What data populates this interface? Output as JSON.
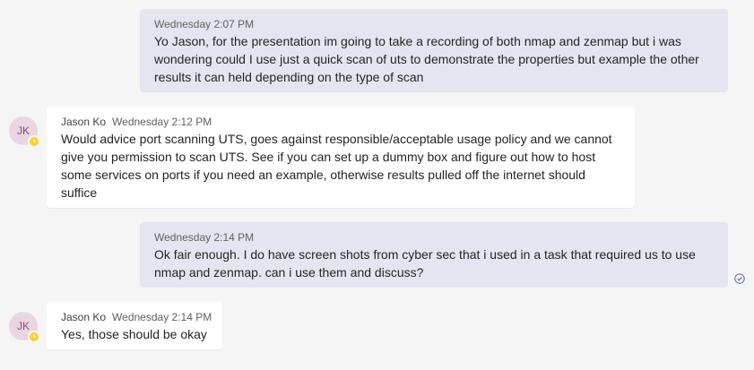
{
  "messages": [
    {
      "sender": "me",
      "timestamp": "Wednesday 2:07 PM",
      "text": "Yo Jason, for the presentation im going to take a recording of both nmap and zenmap but i was wondering could I use just a quick scan of uts to demonstrate the properties but example the other results it can held depending on the type of scan"
    },
    {
      "sender": "other",
      "author": "Jason Ko",
      "initials": "JK",
      "timestamp": "Wednesday 2:12 PM",
      "text": "Would advice port scanning UTS, goes against responsible/acceptable usage policy and we cannot give you permission to scan UTS. See if you can set up a dummy box and figure out how to host some services on ports if you need an example, otherwise results pulled off the internet should suffice"
    },
    {
      "sender": "me",
      "timestamp": "Wednesday 2:14 PM",
      "text": "Ok fair enough. I do have screen shots from cyber sec that i used in a task that required us to use nmap and zenmap. can i use them and discuss?"
    },
    {
      "sender": "other",
      "author": "Jason Ko",
      "initials": "JK",
      "timestamp": "Wednesday 2:14 PM",
      "text": "Yes, those should be okay"
    }
  ],
  "icons": {
    "presence": "away-clock-icon",
    "read_receipt": "seen-check-icon"
  },
  "colors": {
    "background": "#f5f5f5",
    "my_bubble": "#e5e5f1",
    "their_bubble": "#ffffff",
    "avatar_bg": "#e9d6e2",
    "avatar_text": "#8a4a6e",
    "presence_away": "#f8d22a",
    "read_receipt": "#6264a7"
  }
}
